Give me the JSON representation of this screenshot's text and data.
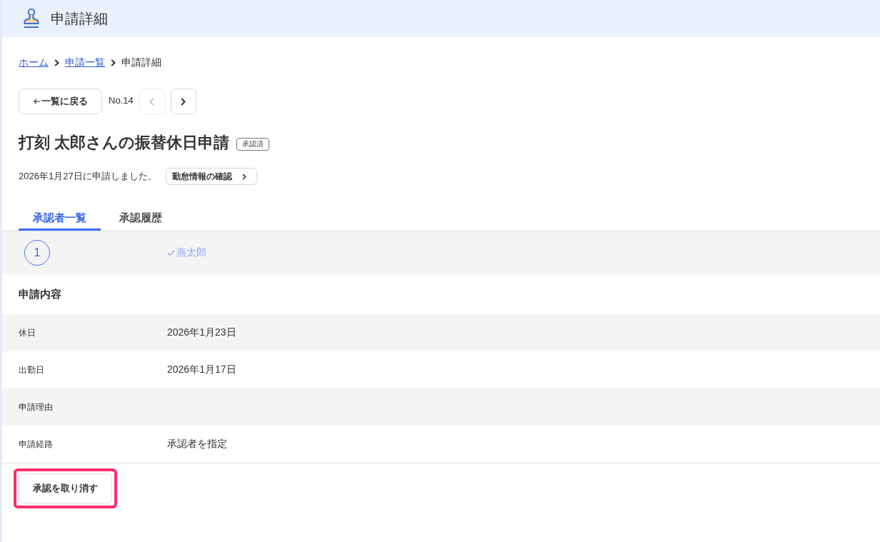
{
  "header": {
    "title": "申請詳細"
  },
  "breadcrumb": [
    {
      "label": "ホーム",
      "link": true
    },
    {
      "label": "申請一覧",
      "link": true
    },
    {
      "label": "申請詳細",
      "link": false
    }
  ],
  "navigation": {
    "back_button": "一覧に戻る",
    "number": "No.14",
    "previous": {
      "disabled": true
    },
    "next": {
      "disabled": false
    }
  },
  "request": {
    "title": "打刻 太郎さんの振替休日申請",
    "status": "承認済",
    "submitted": "2026年1月27日に申請しました。",
    "attendance_button": "勤怠情報の確認"
  },
  "tabs": [
    {
      "label": "承認者一覧",
      "selected": true
    },
    {
      "label": "承認履歴",
      "selected": false
    }
  ],
  "approvers": [
    {
      "step": "1",
      "name": "燕太郎",
      "approved": true
    }
  ],
  "details": {
    "heading": "申請内容",
    "rows": [
      {
        "label": "休日",
        "value": "2026年1月23日"
      },
      {
        "label": "出勤日",
        "value": "2026年1月17日"
      },
      {
        "label": "申請理由"
      },
      {
        "label": "申請経路",
        "value": "承認者を指定"
      }
    ]
  },
  "actions": [
    {
      "label": "承認を取り消す",
      "highlighted": true
    }
  ]
}
